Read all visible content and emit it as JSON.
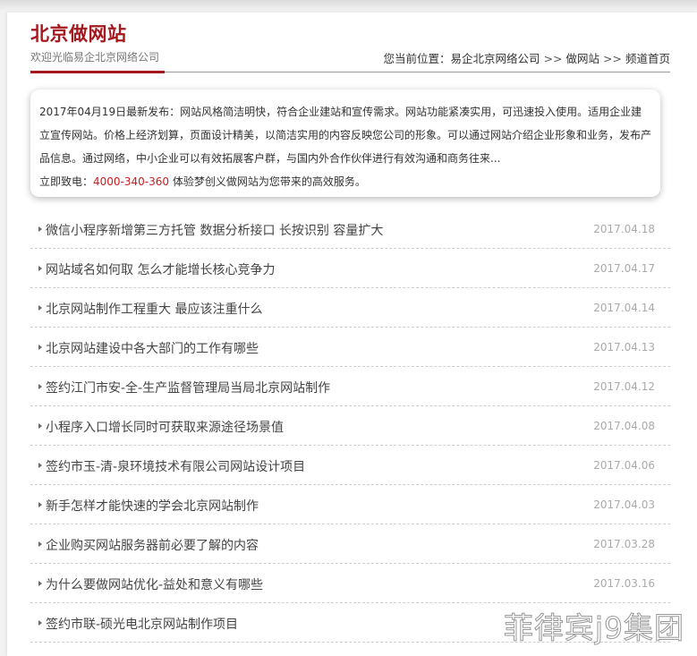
{
  "header": {
    "title": "北京做网站",
    "subtitle": "欢迎光临易企北京网络公司",
    "breadcrumb_prefix": "您当前位置：",
    "breadcrumb": [
      "易企北京网络公司",
      "做网站",
      "频道首页"
    ],
    "separator": ">>"
  },
  "notice": {
    "text": "2017年04月19日最新发布：网站风格简洁明快，符合企业建站和宣传需求。网站功能紧凑实用，可迅速投入使用。适用企业建立宣传网站。价格上经济划算，页面设计精美，以简洁实用的内容反映您公司的形象。可以通过网站介绍企业形象和业务，发布产品信息。通过网络，中小企业可以有效拓展客户群，与国内外合作伙伴进行有效沟通和商务往来...",
    "call_prefix": "立即致电：",
    "phone": "4000-340-360",
    "call_suffix": " 体验梦创义做网站为您带来的高效服务。"
  },
  "news": [
    {
      "title": "微信小程序新增第三方托管 数据分析接口 长按识别 容量扩大",
      "date": "2017.04.18"
    },
    {
      "title": "网站域名如何取 怎么才能增长核心竞争力",
      "date": "2017.04.17"
    },
    {
      "title": "北京网站制作工程重大 最应该注重什么",
      "date": "2017.04.14"
    },
    {
      "title": "北京网站建设中各大部门的工作有哪些",
      "date": "2017.04.13"
    },
    {
      "title": "签约江门市安-全-生产监督管理局当局北京网站制作",
      "date": "2017.04.12"
    },
    {
      "title": "小程序入口增长同时可获取来源途径场景值",
      "date": "2017.04.08"
    },
    {
      "title": "签约市玉-清-泉环境技术有限公司网站设计项目",
      "date": "2017.04.06"
    },
    {
      "title": "新手怎样才能快速的学会北京网站制作",
      "date": "2017.04.03"
    },
    {
      "title": "企业购买网站服务器前必要了解的内容",
      "date": "2017.03.28"
    },
    {
      "title": "为什么要做网站优化-益处和意义有哪些",
      "date": "2017.03.16"
    },
    {
      "title": "签约市联-硕光电北京网站制作项目",
      "date": ""
    }
  ],
  "watermark": "菲律宾j9集团",
  "colors": {
    "brand": "#a5191e",
    "phone": "#cc1a1a",
    "date": "#aaaaaa"
  }
}
